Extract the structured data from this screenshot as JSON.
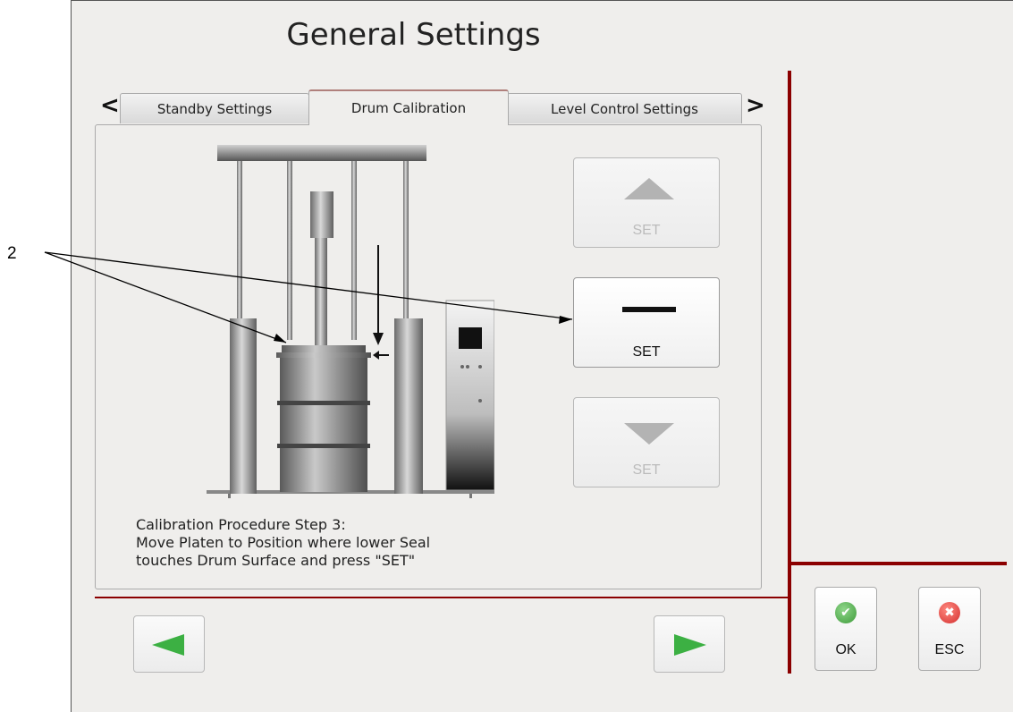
{
  "window": {
    "title": "General Settings"
  },
  "tabs": {
    "prev_glyph": "<",
    "next_glyph": ">",
    "items": [
      {
        "label": "Standby Settings",
        "active": false
      },
      {
        "label": "Drum Calibration",
        "active": true
      },
      {
        "label": "Level Control Settings",
        "active": false
      }
    ]
  },
  "set_buttons": {
    "up_label": "SET",
    "middle_label": "SET",
    "down_label": "SET"
  },
  "instructions": {
    "text": "Calibration Procedure Step 3:\nMove Platen to Position where lower Seal\ntouches Drum Surface and press \"SET\""
  },
  "actions": {
    "ok_label": "OK",
    "esc_label": "ESC",
    "ok_icon": "check-icon",
    "esc_icon": "cross-icon"
  },
  "navigation": {
    "prev_icon": "arrow-left-icon",
    "next_icon": "arrow-right-icon"
  },
  "annotation": {
    "callout_number": "2"
  },
  "colors": {
    "frame_red": "#8b0000",
    "nav_green": "#3cb043",
    "ok_green": "#4caf50",
    "esc_red": "#e53935",
    "background": "#efeeec"
  }
}
